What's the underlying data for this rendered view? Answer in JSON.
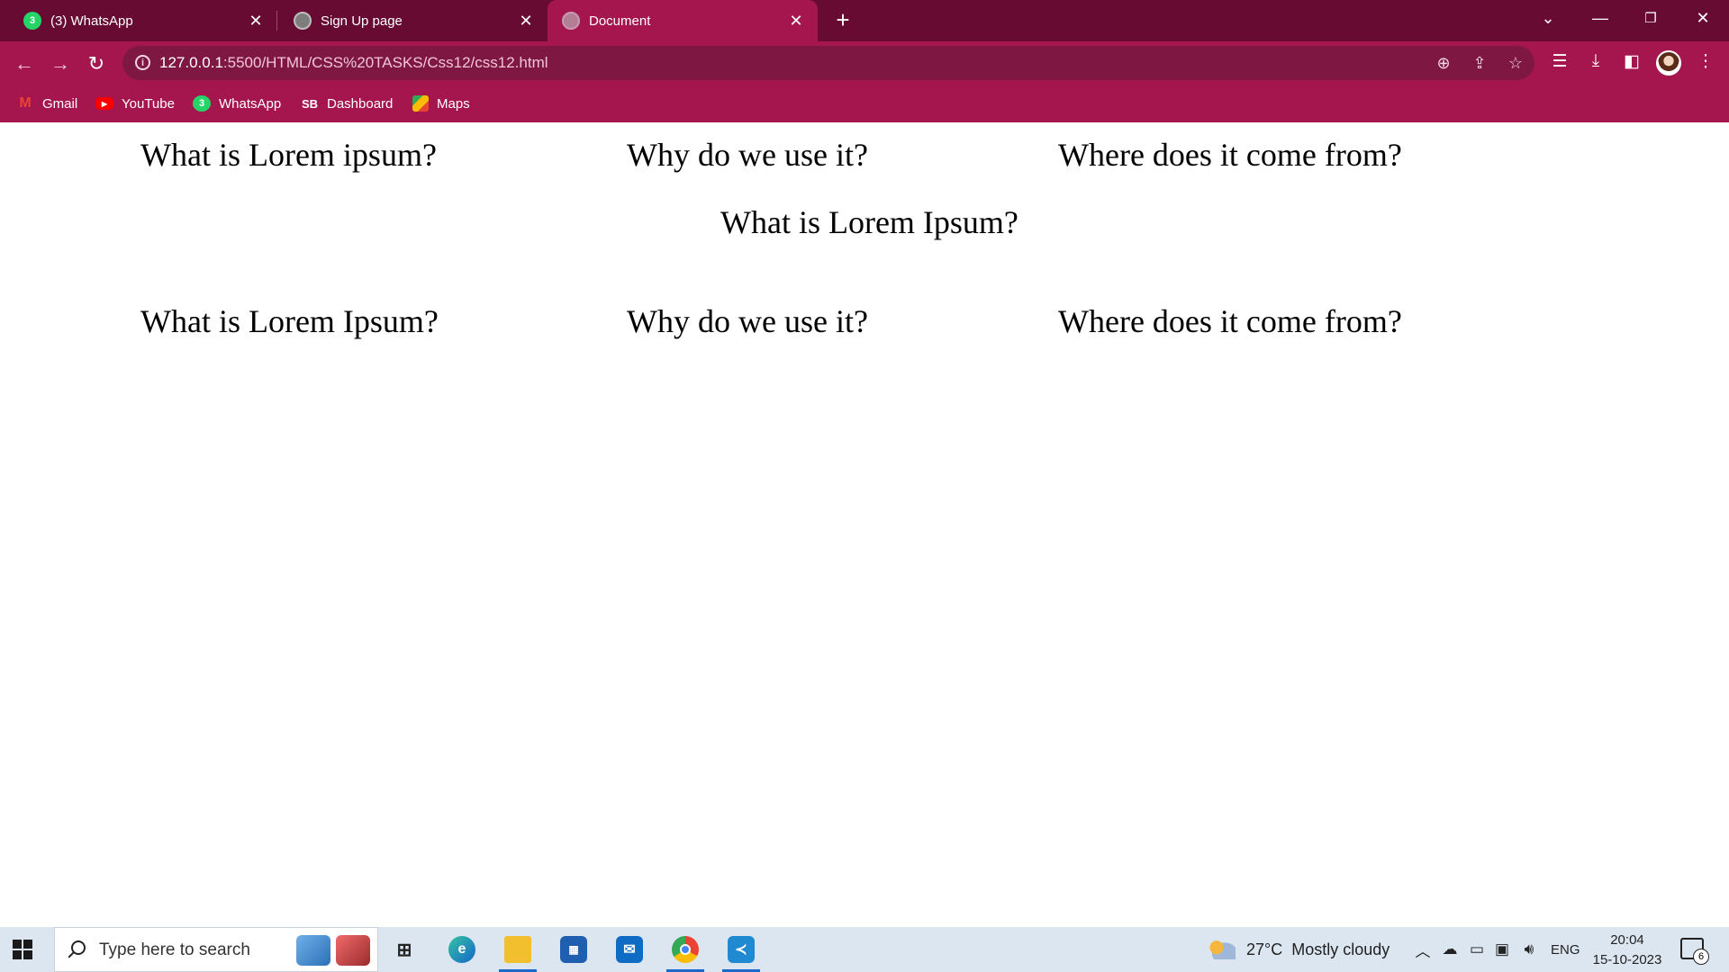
{
  "browser": {
    "tabs": [
      {
        "title": "(3) WhatsApp",
        "favicon": "whatsapp-icon",
        "badge": "3"
      },
      {
        "title": "Sign Up page",
        "favicon": "globe-icon"
      },
      {
        "title": "Document",
        "favicon": "globe-icon"
      }
    ],
    "new_tab": "+",
    "url_host": "127.0.0.1",
    "url_rest": ":5500/HTML/CSS%20TASKS/Css12/css12.html",
    "bookmarks": [
      {
        "label": "Gmail",
        "icon": "gmail-icon"
      },
      {
        "label": "YouTube",
        "icon": "youtube-icon"
      },
      {
        "label": "WhatsApp",
        "icon": "whatsapp-icon",
        "badge": "3"
      },
      {
        "label": "Dashboard",
        "icon": "sb-icon",
        "icon_text": "SB"
      },
      {
        "label": "Maps",
        "icon": "maps-icon"
      }
    ],
    "colors": {
      "tabbar": "#670b33",
      "toolbar": "#a5164f",
      "omnibox": "#7e1842"
    }
  },
  "page": {
    "row1": [
      "What is Lorem ipsum?",
      "Why do we use it?",
      "Where does it come from?"
    ],
    "center_heading": "What is Lorem Ipsum?",
    "row2": [
      "What is Lorem Ipsum?",
      "Why do we use it?",
      "Where does it come from?"
    ]
  },
  "taskbar": {
    "search_placeholder": "Type here to search",
    "weather_temp": "27°C",
    "weather_desc": "Mostly cloudy",
    "language": "ENG",
    "time": "20:04",
    "date": "15-10-2023",
    "notification_count": "6",
    "apps": [
      "task-view-icon",
      "edge-icon",
      "file-explorer-icon",
      "store-icon",
      "mail-icon",
      "chrome-icon",
      "vscode-icon"
    ]
  }
}
